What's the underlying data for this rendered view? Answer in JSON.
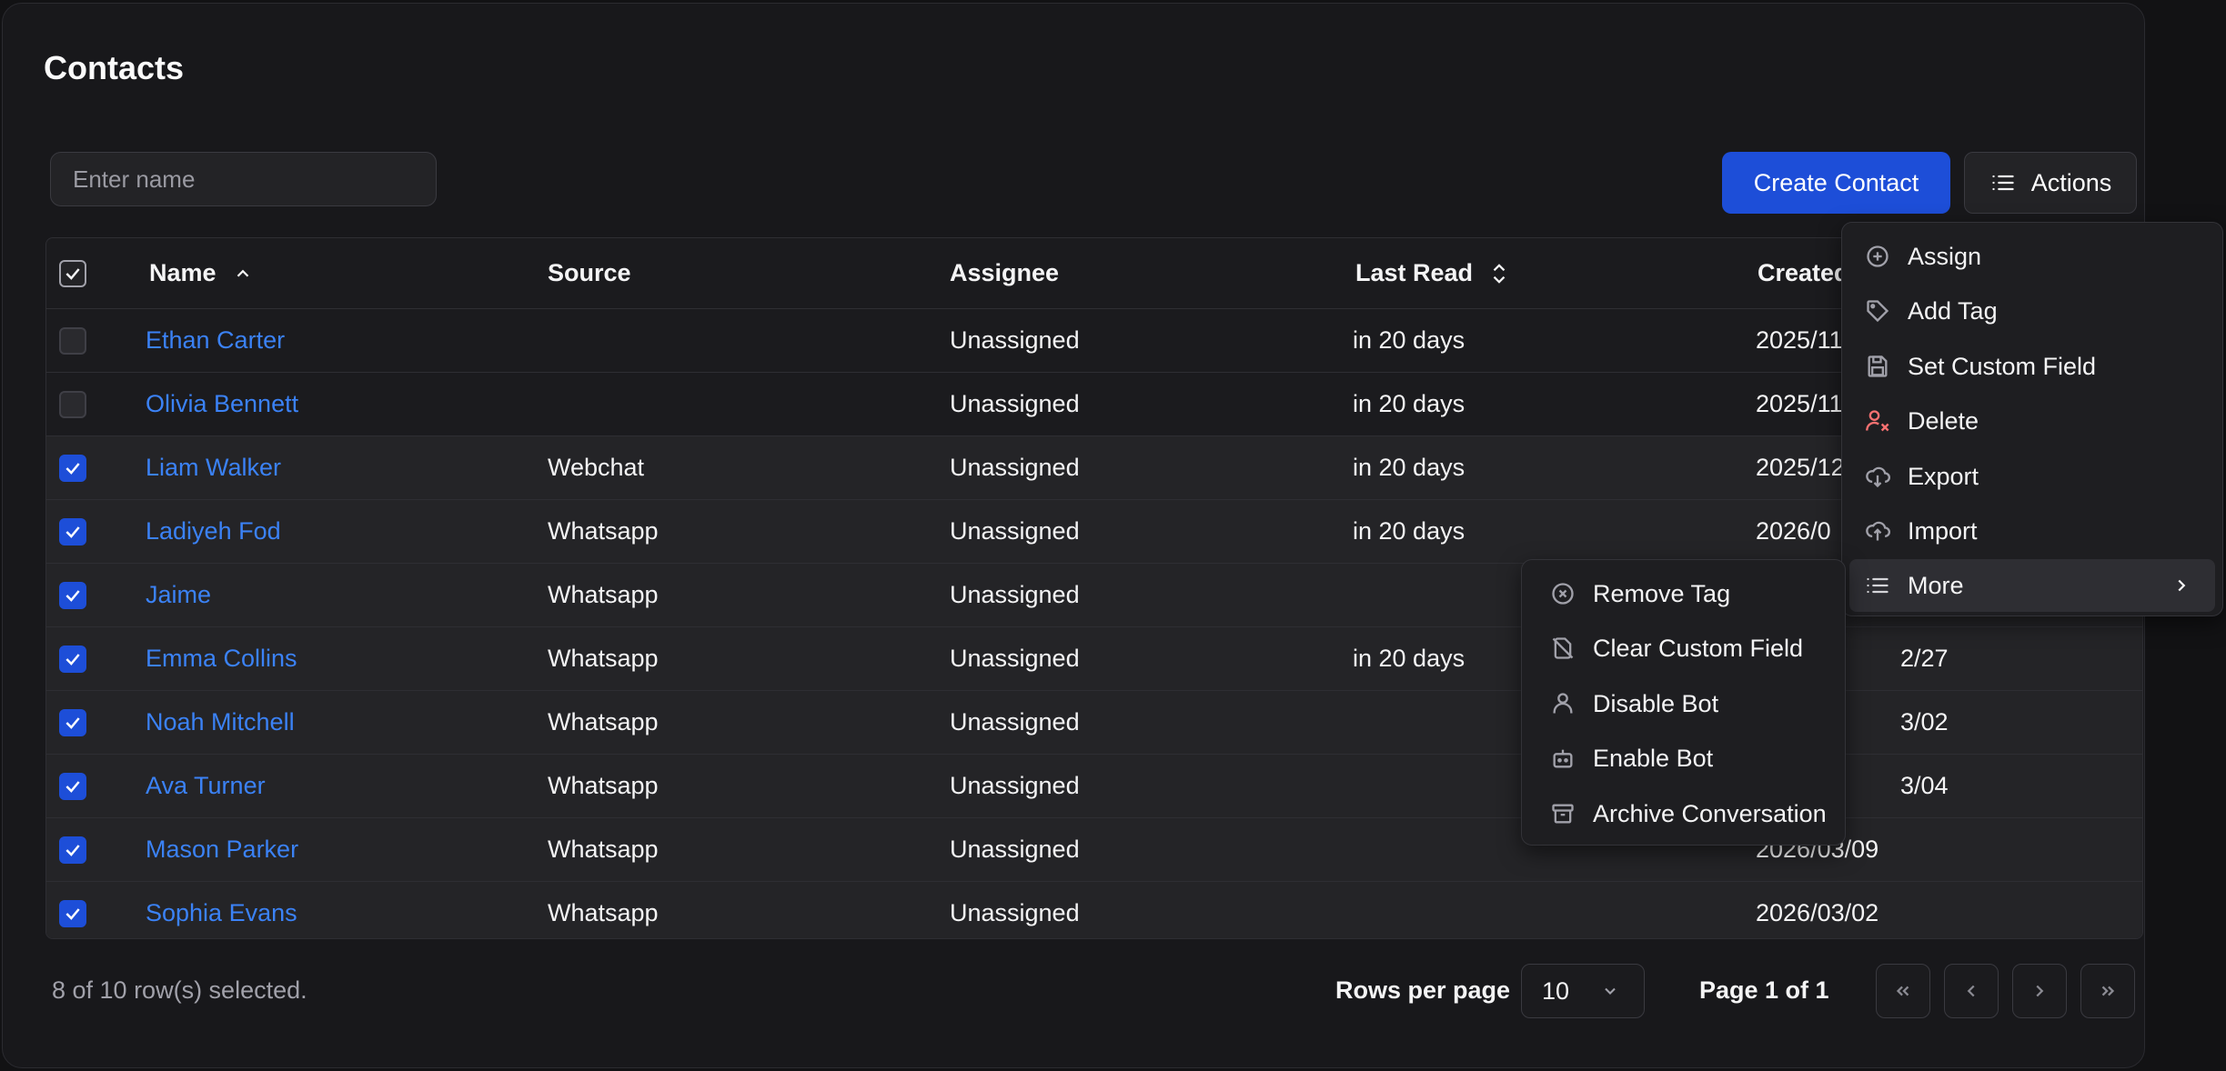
{
  "page": {
    "title": "Contacts"
  },
  "search": {
    "placeholder": "Enter name",
    "value": ""
  },
  "toolbar": {
    "create_label": "Create Contact",
    "actions_label": "Actions"
  },
  "colors": {
    "accent": "#1d4ed8",
    "link": "#3b82f6",
    "danger": "#f87171"
  },
  "table": {
    "columns": [
      "Name",
      "Source",
      "Assignee",
      "Last Read",
      "Created"
    ],
    "sort": {
      "Name": "ascending",
      "Last Read": "sortable"
    },
    "rows": [
      {
        "selected": false,
        "name": "Ethan Carter",
        "source": "",
        "assignee": "Unassigned",
        "last_read": "in 20 days",
        "created": "2025/11"
      },
      {
        "selected": false,
        "name": "Olivia Bennett",
        "source": "",
        "assignee": "Unassigned",
        "last_read": "in 20 days",
        "created": "2025/11"
      },
      {
        "selected": true,
        "name": "Liam Walker",
        "source": "Webchat",
        "assignee": "Unassigned",
        "last_read": "in 20 days",
        "created": "2025/12"
      },
      {
        "selected": true,
        "name": "Ladiyeh Fod",
        "source": "Whatsapp",
        "assignee": "Unassigned",
        "last_read": "in 20 days",
        "created": "2026/0"
      },
      {
        "selected": true,
        "name": "Jaime",
        "source": "Whatsapp",
        "assignee": "Unassigned",
        "last_read": "",
        "created": ""
      },
      {
        "selected": true,
        "name": "Emma Collins",
        "source": "Whatsapp",
        "assignee": "Unassigned",
        "last_read": "in 20 days",
        "created": "2/27"
      },
      {
        "selected": true,
        "name": "Noah Mitchell",
        "source": "Whatsapp",
        "assignee": "Unassigned",
        "last_read": "",
        "created": "3/02"
      },
      {
        "selected": true,
        "name": "Ava Turner",
        "source": "Whatsapp",
        "assignee": "Unassigned",
        "last_read": "",
        "created": "3/04"
      },
      {
        "selected": true,
        "name": "Mason Parker",
        "source": "Whatsapp",
        "assignee": "Unassigned",
        "last_read": "",
        "created": "2026/03/09"
      },
      {
        "selected": true,
        "name": "Sophia Evans",
        "source": "Whatsapp",
        "assignee": "Unassigned",
        "last_read": "",
        "created": "2026/03/02"
      }
    ]
  },
  "footer": {
    "selected_text": "8 of 10 row(s) selected.",
    "rows_per_page_label": "Rows per page",
    "rows_per_page_value": "10",
    "page_info": "Page 1 of 1"
  },
  "actions_menu": {
    "items": [
      {
        "label": "Assign",
        "icon": "plus-circle-icon"
      },
      {
        "label": "Add Tag",
        "icon": "tag-icon"
      },
      {
        "label": "Set Custom Field",
        "icon": "save-icon"
      },
      {
        "label": "Delete",
        "icon": "user-remove-icon"
      },
      {
        "label": "Export",
        "icon": "cloud-download-icon"
      },
      {
        "label": "Import",
        "icon": "cloud-upload-icon"
      },
      {
        "label": "More",
        "icon": "list-icon"
      }
    ]
  },
  "more_submenu": {
    "items": [
      {
        "label": "Remove Tag",
        "icon": "x-circle-icon"
      },
      {
        "label": "Clear Custom Field",
        "icon": "file-off-icon"
      },
      {
        "label": "Disable Bot",
        "icon": "user-icon"
      },
      {
        "label": "Enable Bot",
        "icon": "bot-icon"
      },
      {
        "label": "Archive Conversation",
        "icon": "archive-icon"
      }
    ]
  }
}
